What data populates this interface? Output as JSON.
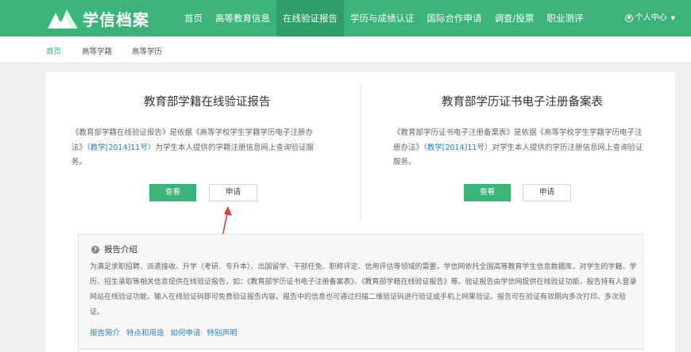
{
  "brand": {
    "logo_text": "学信档案"
  },
  "nav": {
    "items": [
      {
        "label": "首页"
      },
      {
        "label": "高等教育信息"
      },
      {
        "label": "在线验证报告"
      },
      {
        "label": "学历与成绩认证"
      },
      {
        "label": "国际合作申请"
      },
      {
        "label": "调查/投票"
      },
      {
        "label": "职业测评"
      }
    ],
    "active_index": 2,
    "user_center": "个人中心"
  },
  "subnav": {
    "items": [
      {
        "label": "首页"
      },
      {
        "label": "高等学籍"
      },
      {
        "label": "高等学历"
      }
    ]
  },
  "panels": [
    {
      "title": "教育部学籍在线验证报告",
      "desc_pre": "《教育部学籍在线验证报告》是依据《高等学校学生学籍学历电子注册办法》（",
      "desc_link": "教学[2014]11号",
      "desc_post": "）为学生本人提供的学籍注册信息网上查询验证服务。",
      "view_label": "查看",
      "apply_label": "申请"
    },
    {
      "title": "教育部学历证书电子注册备案表",
      "desc_pre": "《教育部学历证书电子注册备案表》是依据《高等学校学生学籍学历电子注册办法》（",
      "desc_link": "教学[2014]11号",
      "desc_post": "）对学生本人提供的学历注册信息网上查询验证服务。",
      "view_label": "查看",
      "apply_label": "申请"
    }
  ],
  "intro": {
    "title": "报告介绍",
    "body": "为满足求职招聘、派遣接收、升学（考研、专升本）、出国留学、干部任免、职称评定、信用评估等领域的需要，学信网依托全国高等教育学生信息数据库，对学生的学籍、学历、招生录取等相关信息提供在线验证报告，如：《教育部学历证书电子注册备案表》、《教育部学籍在线验证报告》等。验证报告由学信网提供在线验证功能，报告持有人登录网站在线验证功能，输入在线验证码即可免费验证报告内容。报告中的信息也可通过扫描二维验证码进行验证或手机上网果验证。报告可在验证有效期内多次打印、多次验证。",
    "links": [
      {
        "label": "报告简介"
      },
      {
        "label": "特点和用途"
      },
      {
        "label": "如何申请"
      },
      {
        "label": "特别声明"
      }
    ]
  },
  "colors": {
    "brand_green": "#3bb47a",
    "link_blue": "#2b7fc5",
    "arrow_red": "#e53935"
  }
}
